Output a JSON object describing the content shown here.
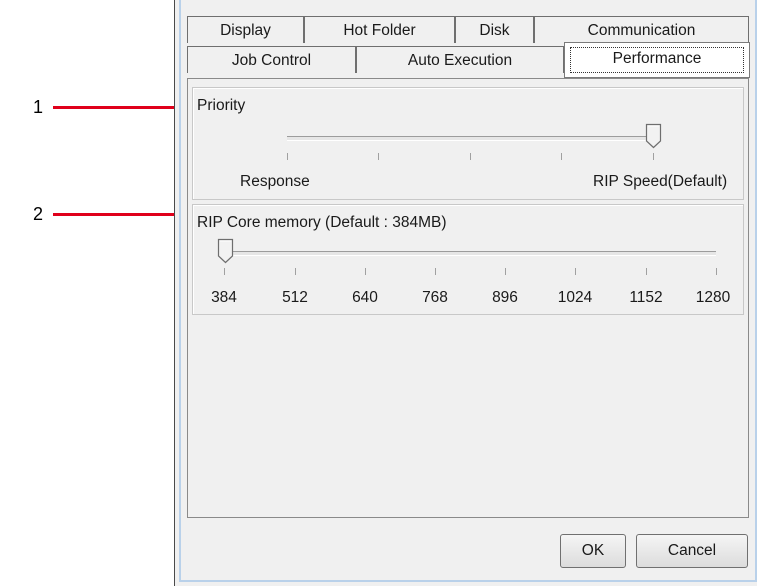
{
  "callouts": [
    "1",
    "2"
  ],
  "tabs_top": [
    "Display",
    "Hot Folder",
    "Disk",
    "Communication"
  ],
  "tabs_bottom": [
    "Job Control",
    "Auto Execution",
    "Performance"
  ],
  "active_tab": "Performance",
  "priority": {
    "label": "Priority",
    "left_label": "Response",
    "right_label": "RIP Speed(Default)",
    "tick_count": 5,
    "selected_index": 4
  },
  "memory": {
    "label": "RIP Core memory (Default : 384MB)",
    "values": [
      "384",
      "512",
      "640",
      "768",
      "896",
      "1024",
      "1152",
      "1280"
    ],
    "selected": "384"
  },
  "buttons": {
    "ok": "OK",
    "cancel": "Cancel"
  },
  "colors": {
    "callout": "#e0001b",
    "frame": "#b9d1ea"
  }
}
